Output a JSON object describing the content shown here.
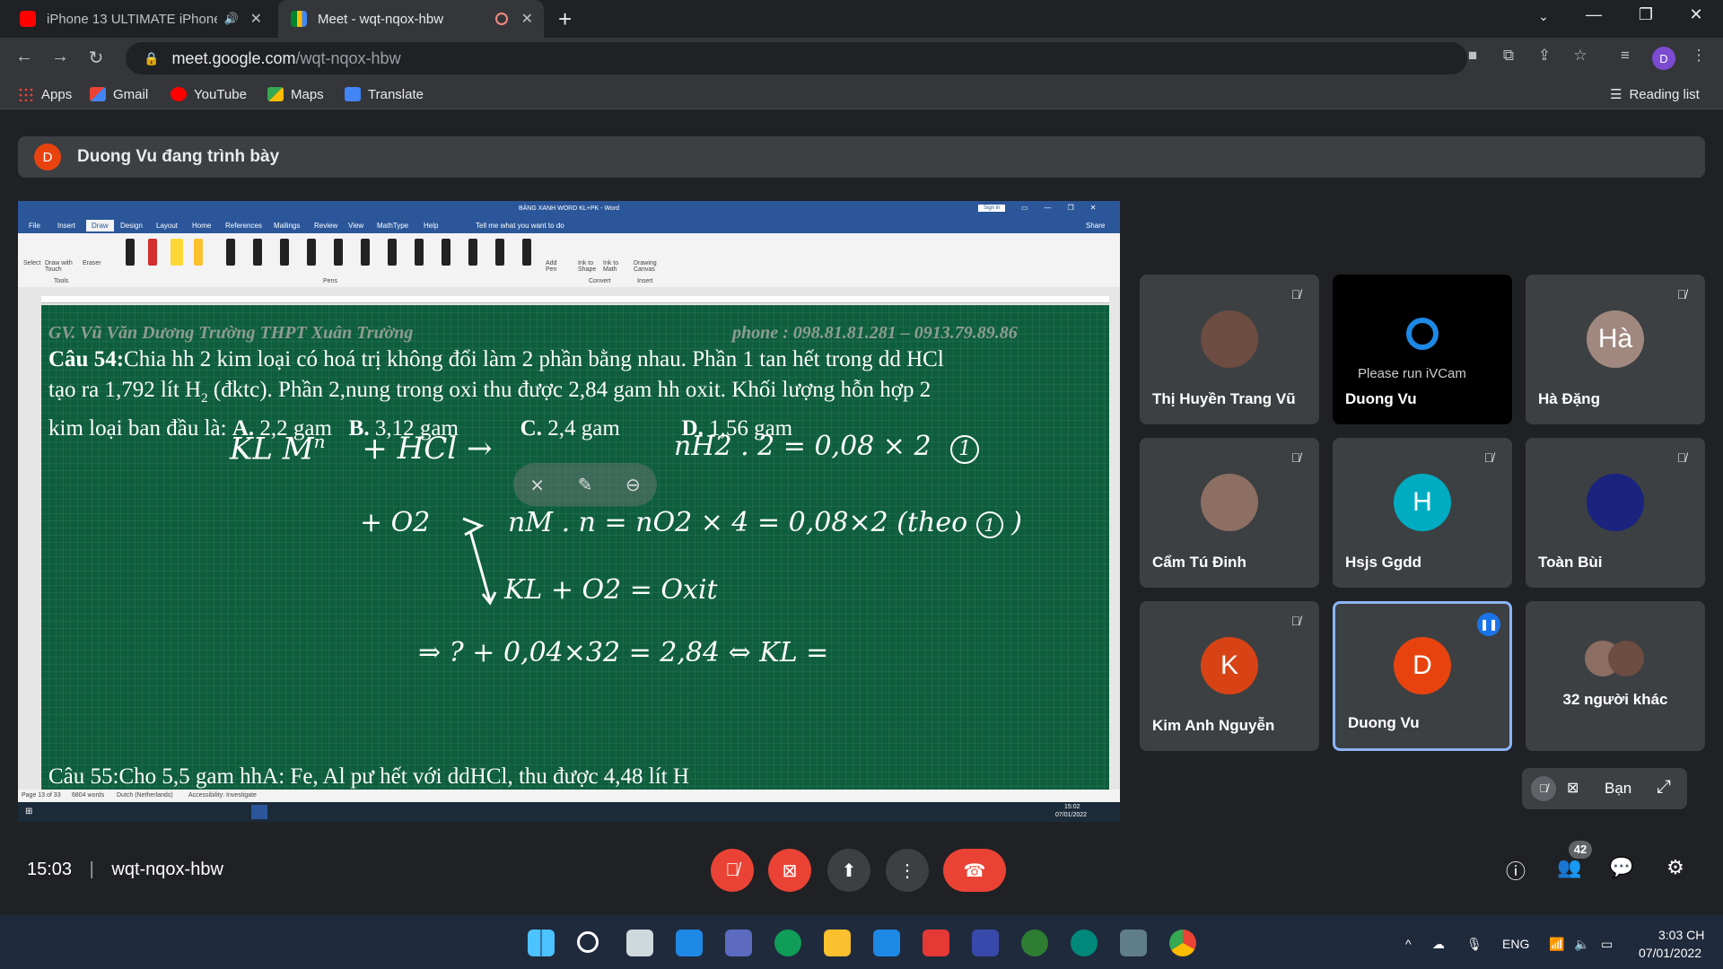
{
  "browser": {
    "tabs": [
      {
        "title": "iPhone 13 ULTIMATE iPhone",
        "active": false
      },
      {
        "title": "Meet - wqt-nqox-hbw",
        "active": true
      }
    ],
    "url_host": "meet.google.com",
    "url_path": "/wqt-nqox-hbw",
    "profile_initial": "D",
    "bookmarks": [
      "Apps",
      "Gmail",
      "YouTube",
      "Maps",
      "Translate"
    ],
    "reading_list": "Reading list"
  },
  "meet": {
    "presenter_initial": "D",
    "presenter_text": "Duong Vu đang trình bày",
    "time": "15:03",
    "meeting_code": "wqt-nqox-hbw",
    "participant_count": "42",
    "self_label": "Bạn",
    "participants": [
      {
        "name": "Thị Huyền Trang Vũ",
        "initial": "",
        "color": "#6d4c41"
      },
      {
        "name": "Duong Vu",
        "initial": "",
        "color": "#000000",
        "note": "Please run iVCam"
      },
      {
        "name": "Hà Đặng",
        "initial": "Hà",
        "color": "#a1887f"
      },
      {
        "name": "Cẩm Tú Đinh",
        "initial": "",
        "color": "#8d6e63"
      },
      {
        "name": "Hsjs Ggdd",
        "initial": "H",
        "color": "#00acc1"
      },
      {
        "name": "Toàn Bùi",
        "initial": "",
        "color": "#1a237e"
      },
      {
        "name": "Kim Anh Nguyễn",
        "initial": "K",
        "color": "#d84315"
      },
      {
        "name": "Duong Vu",
        "initial": "D",
        "color": "#e8430f"
      },
      {
        "name": "32 người khác",
        "initial": "",
        "color": "#5f6368"
      }
    ]
  },
  "word": {
    "title": "BẢNG XANH WORD KL+PK - Word",
    "sign_in": "Sign in",
    "share": "Share",
    "tell_me": "Tell me what you want to do",
    "menu": [
      "File",
      "Insert",
      "Draw",
      "Design",
      "Layout",
      "Home",
      "References",
      "Mailings",
      "Review",
      "View",
      "MathType",
      "Help"
    ],
    "ribbon_tools": [
      "Select",
      "Draw with Touch",
      "Eraser"
    ],
    "ribbon_groups": [
      "Tools",
      "Pens",
      "Convert",
      "Insert"
    ],
    "ribbon_buttons": [
      "Add Pen",
      "Ink to Shape",
      "Ink to Math",
      "Drawing Canvas"
    ],
    "status_page": "Page 13 of 33",
    "status_words": "6804 words",
    "status_lang": "Dutch (Netherlands)",
    "status_access": "Accessibility: Investigate",
    "taskbar_time": "15:02",
    "taskbar_date": "07/01/2022"
  },
  "board": {
    "header_left": "GV. Vũ Văn Dương Trường THPT Xuân Trường",
    "header_right": "phone : 098.81.81.281 – 0913.79.89.86",
    "q_label": "Câu 54:",
    "q_line1": "Chia hh 2 kim loại có hoá trị không đổi làm 2 phần bằng nhau. Phần 1 tan hết trong dd HCl",
    "q_line2a": "tạo ra 1,792 lít H",
    "q_line2_sub": "2",
    "q_line2b": " (đktc). Phần 2,nung trong oxi thu được 2,84 gam hh oxit. Khối lượng hỗn hợp 2",
    "q_line3a": "kim loại ban đầu là: ",
    "opt_a": "A.",
    "opt_a_val": " 2,2 gam   ",
    "opt_b": "B.",
    "opt_b_val": " 3,12 gam           ",
    "opt_c": "C.",
    "opt_c_val": " 2,4 gam           ",
    "opt_d": "D.",
    "opt_d_val": " 1,56 gam",
    "next_q": "Câu 55:Cho 5,5 gam hhA: Fe, Al pư hết với ddHCl, thu được 4,48 lít H",
    "hw1": "KL M",
    "hw1_sup": "n",
    "hw1b": "+ HCl →",
    "hw1c": "nH2 . 2  =  0,08 × 2",
    "hw1_circ": "1",
    "hw2": "+ O2",
    "hw2b": "nM . n  =  nO2 × 4  =  0,08×2 (theo",
    "hw2_circ": "1",
    "hw3": "KL  + O2   =  Oxit",
    "hw4": "⇒      ?   + 0,04×32  =  2,84  ⇔  KL ="
  },
  "taskbar": {
    "lang": "ENG",
    "time": "3:03 CH",
    "date": "07/01/2022"
  }
}
